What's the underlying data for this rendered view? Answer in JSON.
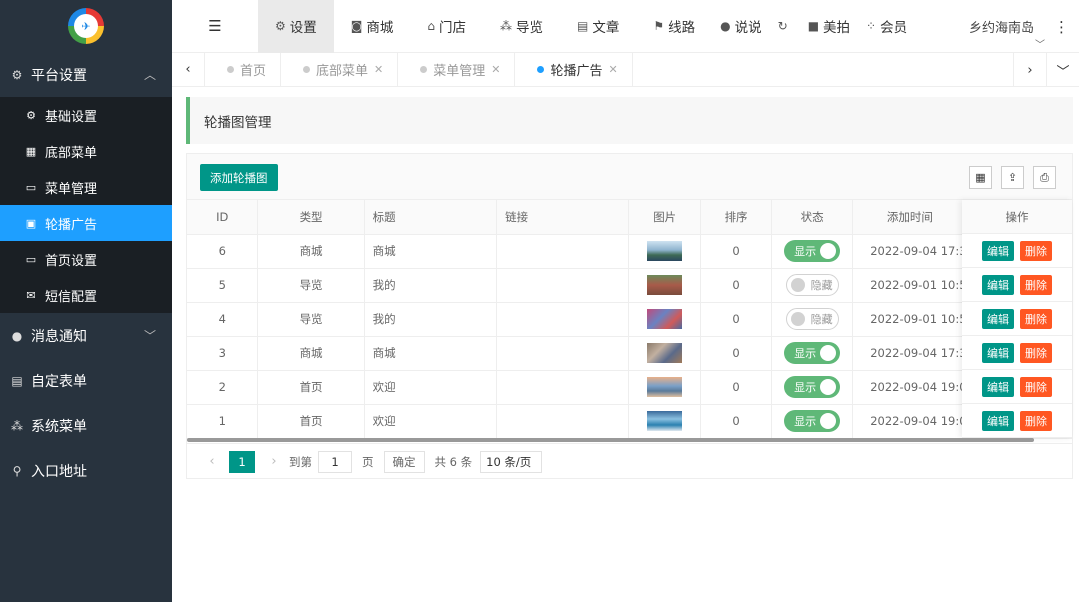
{
  "sidebar": {
    "groups": [
      {
        "label": "平台设置",
        "icon": "gear-icon"
      },
      {
        "label": "消息通知",
        "icon": "chat-icon"
      },
      {
        "label": "自定表单",
        "icon": "form-icon"
      },
      {
        "label": "系统菜单",
        "icon": "nodes-icon"
      },
      {
        "label": "入口地址",
        "icon": "search-icon"
      }
    ],
    "sub_items": [
      {
        "label": "基础设置",
        "icon": "gear-icon"
      },
      {
        "label": "底部菜单",
        "icon": "grid-icon"
      },
      {
        "label": "菜单管理",
        "icon": "monitor-icon"
      },
      {
        "label": "轮播广告",
        "icon": "image-icon"
      },
      {
        "label": "首页设置",
        "icon": "monitor-icon"
      },
      {
        "label": "短信配置",
        "icon": "mail-icon"
      }
    ]
  },
  "header": {
    "items": [
      {
        "label": "设置",
        "icon": "gears-icon"
      },
      {
        "label": "商城",
        "icon": "bag-icon"
      },
      {
        "label": "门店",
        "icon": "bank-icon"
      },
      {
        "label": "导览",
        "icon": "nodes-icon"
      },
      {
        "label": "文章",
        "icon": "newspaper-icon"
      },
      {
        "label": "线路",
        "icon": "route-icon"
      },
      {
        "label": "说说",
        "icon": "comments-icon"
      },
      {
        "label": "",
        "icon": "refresh-icon"
      },
      {
        "label": "美拍",
        "icon": "video-icon"
      },
      {
        "label": "会员",
        "icon": "sitemap-icon"
      }
    ],
    "user_name": "乡约海南岛"
  },
  "tabs": [
    {
      "label": "首页"
    },
    {
      "label": "底部菜单"
    },
    {
      "label": "菜单管理"
    },
    {
      "label": "轮播广告"
    }
  ],
  "page_title": "轮播图管理",
  "toolbar": {
    "add_label": "添加轮播图"
  },
  "table": {
    "headers": {
      "id": "ID",
      "type": "类型",
      "title": "标题",
      "link": "链接",
      "image": "图片",
      "sort": "排序",
      "status": "状态",
      "time": "添加时间",
      "ops": "操作"
    },
    "rows": [
      {
        "id": "6",
        "type": "商城",
        "title": "商城",
        "link": "",
        "sort": "0",
        "status": "显示",
        "time": "2022-09-04 17:3",
        "edit": "编辑",
        "delete": "删除"
      },
      {
        "id": "5",
        "type": "导览",
        "title": "我的",
        "link": "",
        "sort": "0",
        "status": "隐藏",
        "time": "2022-09-01 10:5",
        "edit": "编辑",
        "delete": "删除"
      },
      {
        "id": "4",
        "type": "导览",
        "title": "我的",
        "link": "",
        "sort": "0",
        "status": "隐藏",
        "time": "2022-09-01 10:5",
        "edit": "编辑",
        "delete": "删除"
      },
      {
        "id": "3",
        "type": "商城",
        "title": "商城",
        "link": "",
        "sort": "0",
        "status": "显示",
        "time": "2022-09-04 17:3",
        "edit": "编辑",
        "delete": "删除"
      },
      {
        "id": "2",
        "type": "首页",
        "title": "欢迎",
        "link": "",
        "sort": "0",
        "status": "显示",
        "time": "2022-09-04 19:0",
        "edit": "编辑",
        "delete": "删除"
      },
      {
        "id": "1",
        "type": "首页",
        "title": "欢迎",
        "link": "",
        "sort": "0",
        "status": "显示",
        "time": "2022-09-04 19:0",
        "edit": "编辑",
        "delete": "删除"
      }
    ]
  },
  "pager": {
    "current": "1",
    "goto_label": "到第",
    "goto_value": "1",
    "page_unit": "页",
    "confirm": "确定",
    "total": "共 6 条",
    "page_size": "10 条/页"
  },
  "colors": {
    "primary": "#009688",
    "danger": "#ff5722",
    "switch_on": "#5fb878",
    "active_tab": "#1e9fff",
    "sidebar_bg": "#28333e"
  }
}
